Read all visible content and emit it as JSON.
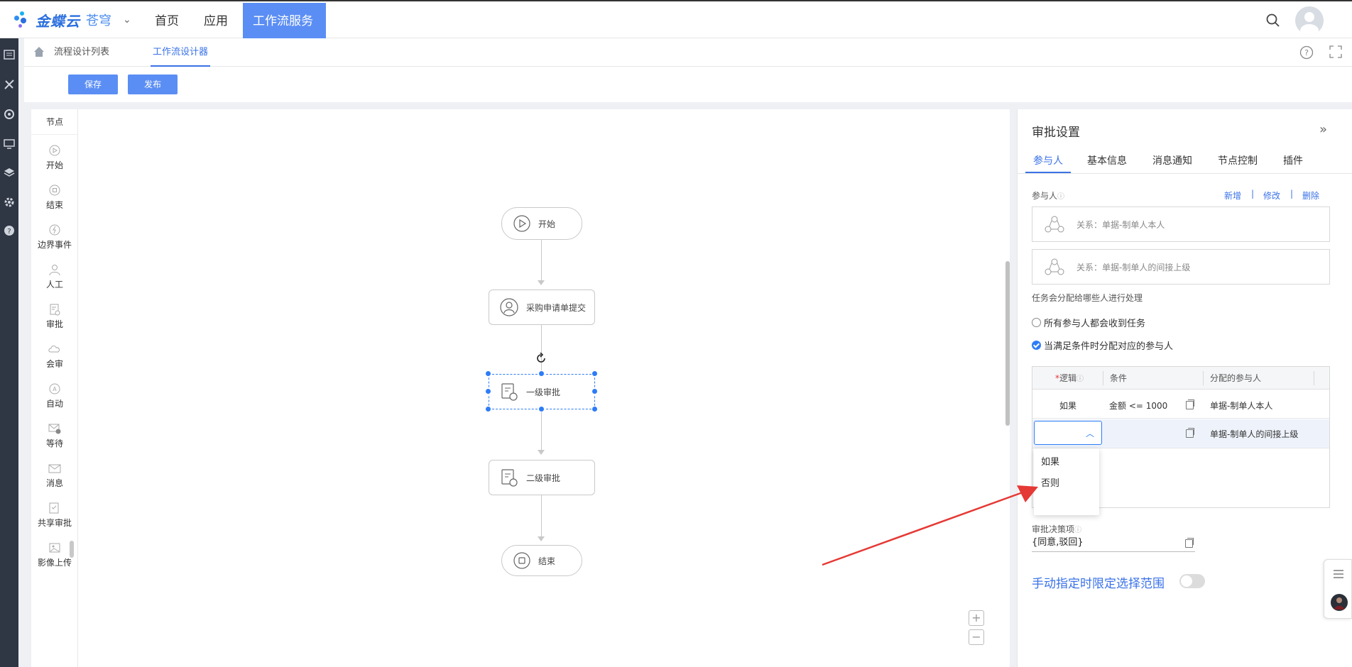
{
  "header": {
    "brand": "金蝶云",
    "brand_sub": "苍穹",
    "nav": [
      "首页",
      "应用",
      "工作流服务"
    ],
    "colors": {
      "accent": "#5b8ef4",
      "link": "#3a72e8",
      "rail": "#2f3644"
    }
  },
  "breadcrumb": {
    "items": [
      "流程设计列表",
      "工作流设计器"
    ]
  },
  "toolbar": {
    "save": "保存",
    "publish": "发布"
  },
  "node_panel": {
    "title": "节点",
    "items": [
      {
        "label": "开始",
        "icon": "play-circle-icon"
      },
      {
        "label": "结束",
        "icon": "stop-circle-icon"
      },
      {
        "label": "边界事件",
        "icon": "lightning-icon"
      },
      {
        "label": "人工",
        "icon": "person-icon"
      },
      {
        "label": "审批",
        "icon": "approval-doc-icon"
      },
      {
        "label": "会审",
        "icon": "cloud-icon"
      },
      {
        "label": "自动",
        "icon": "auto-icon"
      },
      {
        "label": "等待",
        "icon": "envelope-clock-icon"
      },
      {
        "label": "消息",
        "icon": "envelope-icon"
      },
      {
        "label": "共享审批",
        "icon": "shared-approval-icon"
      },
      {
        "label": "影像上传",
        "icon": "image-upload-icon"
      }
    ]
  },
  "flow": {
    "start": "开始",
    "submit": "采购申请单提交",
    "level1": "一级审批",
    "level2": "二级审批",
    "end": "结束"
  },
  "settings": {
    "title": "审批设置",
    "tabs": [
      "参与人",
      "基本信息",
      "消息通知",
      "节点控制",
      "插件"
    ],
    "participants_label": "参与人",
    "actions": {
      "add": "新增",
      "edit": "修改",
      "delete": "删除"
    },
    "participants": [
      "关系：单据-制单人本人",
      "关系：单据-制单人的间接上级"
    ],
    "assign_hint": "任务会分配给哪些人进行处理",
    "radio_all": "所有参与人都会收到任务",
    "radio_cond": "当满足条件时分配对应的参与人",
    "table": {
      "headers": {
        "logic": "逻辑",
        "condition": "条件",
        "assignee": "分配的参与人"
      },
      "rows": [
        {
          "logic": "如果",
          "condition": "金额 <= 1000",
          "assignee": "单据-制单人本人"
        },
        {
          "logic": "",
          "condition": "",
          "assignee": "单据-制单人的间接上级"
        }
      ]
    },
    "dropdown_options": [
      "如果",
      "否则"
    ],
    "decision_label": "审批决策项",
    "decision_value": "{同意,驳回}",
    "range_label": "手动指定时限定选择范围",
    "range_enabled": false
  }
}
